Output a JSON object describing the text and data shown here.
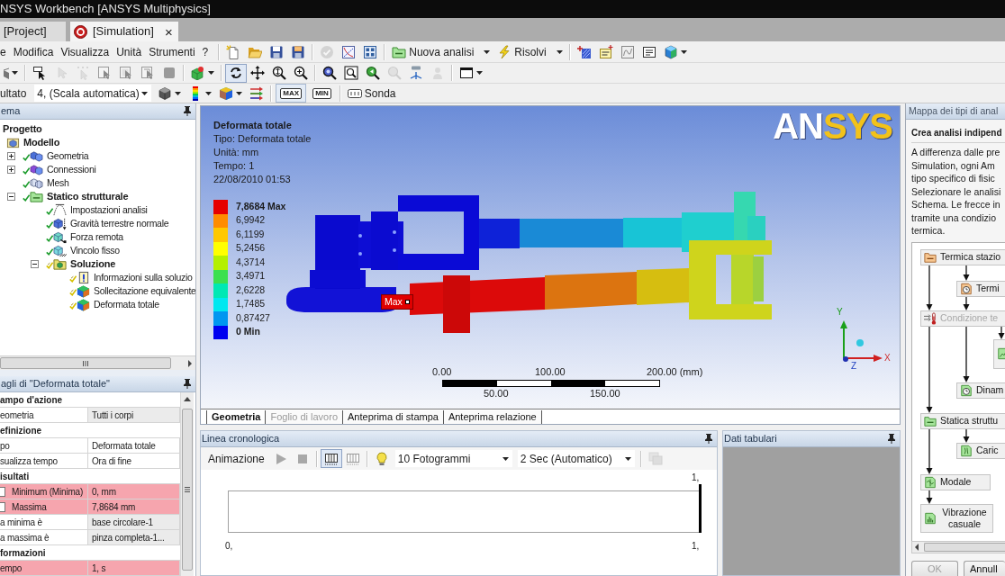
{
  "window": {
    "title": "NSYS Workbench [ANSYS Multiphysics]"
  },
  "tabs": [
    {
      "label": "[Project]",
      "selected": false
    },
    {
      "label": "[Simulation]",
      "selected": true,
      "kind": "simulation",
      "close": "×"
    }
  ],
  "menu": [
    "e",
    "Modifica",
    "Visualizza",
    "Unità",
    "Strumenti",
    "?"
  ],
  "toolbar_main": [
    [
      {
        "kind": "new",
        "disabled": false
      },
      {
        "kind": "open",
        "disabled": false
      },
      {
        "kind": "save",
        "disabled": false
      },
      {
        "kind": "save-all",
        "disabled": false
      }
    ],
    [
      {
        "kind": "check",
        "disabled": true
      },
      {
        "kind": "graph",
        "disabled": false
      },
      {
        "kind": "slides",
        "disabled": false
      }
    ],
    [
      {
        "kind": "analysis",
        "label": "Nuova analisi",
        "dropdown": true,
        "disabled": false
      },
      {
        "kind": "solve",
        "label": "Risolvi",
        "dropdown": true,
        "disabled": false
      }
    ],
    [
      {
        "kind": "annotation",
        "disabled": false
      },
      {
        "kind": "label",
        "disabled": false
      },
      {
        "kind": "chart",
        "disabled": false
      },
      {
        "kind": "text",
        "disabled": false
      },
      {
        "kind": "color-cube",
        "dropdown": true,
        "disabled": false
      }
    ]
  ],
  "toolbar_view": [
    [
      {
        "kind": "mode",
        "dropdown": true
      }
    ],
    [
      {
        "kind": "pointer",
        "disabled": false
      },
      {
        "kind": "vertex",
        "disabled": true
      },
      {
        "kind": "coords",
        "disabled": true
      },
      {
        "kind": "edge-select",
        "disabled": false
      },
      {
        "kind": "face-select",
        "disabled": false
      },
      {
        "kind": "box-select",
        "disabled": false
      },
      {
        "kind": "body",
        "disabled": false
      }
    ],
    [
      {
        "kind": "cube-add",
        "dropdown": true
      }
    ],
    [
      {
        "kind": "rotate",
        "pressed": true
      },
      {
        "kind": "pan",
        "pressed": false
      },
      {
        "kind": "zoom",
        "pressed": false
      },
      {
        "kind": "zoom-in",
        "pressed": false
      }
    ],
    [
      {
        "kind": "zoom-fit",
        "disabled": false
      },
      {
        "kind": "zoom-box",
        "disabled": false
      },
      {
        "kind": "previous",
        "disabled": false
      },
      {
        "kind": "next",
        "disabled": true
      },
      {
        "kind": "iso",
        "disabled": false
      },
      {
        "kind": "face-view",
        "disabled": true
      }
    ],
    [
      {
        "kind": "window",
        "dropdown": true
      }
    ]
  ],
  "toolbar_result": [
    [
      {
        "kind": "caption",
        "label": "ultato"
      },
      {
        "kind": "dropdown",
        "label": "4, (Scala automatica)"
      },
      {
        "kind": "display",
        "dropdown": true
      },
      {
        "kind": "legend",
        "dropdown": true
      },
      {
        "kind": "contour",
        "dropdown": true
      },
      {
        "kind": "vectors"
      }
    ],
    [
      {
        "kind": "max",
        "label": "MAX",
        "pressed": true
      },
      {
        "kind": "min",
        "label": "MIN",
        "pressed": false
      }
    ],
    [
      {
        "kind": "probe",
        "label": "Sonda"
      }
    ]
  ],
  "outline": {
    "title": "ema",
    "tree": [
      {
        "label": "Progetto",
        "children": [
          {
            "label": "Modello",
            "kind": "model",
            "children": [
              {
                "label": "Geometria",
                "kind": "geometry",
                "pending": false,
                "expanded": false
              },
              {
                "label": "Connessioni",
                "kind": "connections",
                "pending": false,
                "expanded": false
              },
              {
                "label": "Mesh",
                "kind": "mesh",
                "pending": false
              },
              {
                "label": "Statico strutturale",
                "kind": "analysis",
                "pending": false,
                "expanded": true,
                "children": [
                  {
                    "label": "Impostazioni analisi",
                    "kind": "settings",
                    "pending": false
                  },
                  {
                    "label": "Gravità terrestre normale",
                    "kind": "gravity",
                    "pending": false
                  },
                  {
                    "label": "Forza remota",
                    "kind": "force",
                    "pending": false
                  },
                  {
                    "label": "Vincolo fisso",
                    "kind": "support",
                    "pending": false
                  },
                  {
                    "label": "Soluzione",
                    "kind": "solution",
                    "pending": true,
                    "expanded": true,
                    "children": [
                      {
                        "label": "Informazioni sulla soluzio",
                        "kind": "info",
                        "pending": true
                      },
                      {
                        "label": "Sollecitazione equivalente",
                        "kind": "result",
                        "pending": true
                      },
                      {
                        "label": "Deformata totale",
                        "kind": "result",
                        "pending": true
                      }
                    ]
                  }
                ]
              }
            ]
          }
        ]
      }
    ]
  },
  "details": {
    "title": "agli di \"Deformata totale\"",
    "rows": [
      {
        "kind": "section",
        "label": "ampo d'azione"
      },
      {
        "kind": "readonly",
        "label": "eometria",
        "value": "Tutti i corpi"
      },
      {
        "kind": "section",
        "label": "efinizione"
      },
      {
        "kind": "input",
        "label": "po",
        "value": "Deformata totale"
      },
      {
        "kind": "input",
        "label": "sualizza tempo",
        "value": "Ora di fine"
      },
      {
        "kind": "section",
        "label": "isultati"
      },
      {
        "kind": "result",
        "label": "Minimum (Minima)",
        "value": "0, mm",
        "checked": false
      },
      {
        "kind": "result",
        "label": "Massima",
        "value": "7,8684 mm",
        "checked": false
      },
      {
        "kind": "readonly",
        "label": "a minima è",
        "value": "base circolare-1"
      },
      {
        "kind": "readonly",
        "label": "a massima è",
        "value": "pinza completa-1..."
      },
      {
        "kind": "section",
        "label": "formazioni"
      },
      {
        "kind": "result",
        "label": "empo",
        "value": "1, s"
      }
    ]
  },
  "viewport": {
    "title": "Deformata totale",
    "info": [
      "Tipo: Deformata totale",
      "Unità: mm",
      "Tempo: 1",
      "22/08/2010 01:53"
    ],
    "logo": [
      "AN",
      "SYS"
    ],
    "legend": [
      {
        "label": "7,8684 Max",
        "color": "#e60000"
      },
      {
        "label": "6,9942",
        "color": "#ff8c00"
      },
      {
        "label": "6,1199",
        "color": "#ffc800"
      },
      {
        "label": "5,2456",
        "color": "#ffff00"
      },
      {
        "label": "4,3714",
        "color": "#b4f000"
      },
      {
        "label": "3,4971",
        "color": "#3ce050"
      },
      {
        "label": "2,6228",
        "color": "#00e8b4"
      },
      {
        "label": "1,7485",
        "color": "#00e8f0"
      },
      {
        "label": "0,87427",
        "color": "#0096f0"
      },
      {
        "label": "0 Min",
        "color": "#0000f0"
      }
    ],
    "probe_tag": "Max",
    "axes": {
      "y": "Y",
      "x": "X",
      "z": "Z"
    },
    "scale": {
      "above": [
        "0.00",
        "100.00",
        "200.00 (mm)"
      ],
      "below": [
        "50.00",
        "150.00"
      ]
    },
    "tabs": [
      {
        "label": "Geometria",
        "selected": true,
        "disabled": false
      },
      {
        "label": "Foglio di lavoro",
        "selected": false,
        "disabled": true
      },
      {
        "label": "Anteprima di stampa",
        "selected": false,
        "disabled": false
      },
      {
        "label": "Anteprima relazione",
        "selected": false,
        "disabled": false
      }
    ]
  },
  "timeline": {
    "title": "Linea cronologica",
    "toolbar": [
      [
        {
          "kind": "caption",
          "label": "Animazione"
        },
        {
          "kind": "play"
        },
        {
          "kind": "stop"
        }
      ],
      [
        {
          "kind": "frames",
          "pressed": true
        },
        {
          "kind": "frames-alt",
          "pressed": false
        }
      ],
      [
        {
          "kind": "bulb"
        },
        {
          "kind": "dropdown",
          "label": "10 Fotogrammi"
        },
        {
          "kind": "dropdown",
          "label": "2 Sec (Automatico)"
        }
      ],
      [
        {
          "kind": "export",
          "disabled": true
        }
      ]
    ],
    "axis": {
      "current": "1,",
      "start": "0,",
      "end": "1,"
    }
  },
  "tabular_data": {
    "title": "Dati tabulari"
  },
  "analysis_map": {
    "title": "Mappa dei tipi di anal",
    "heading": "Crea analisi indipend",
    "text_lines": [
      "A differenza dalle pre",
      "Simulation, ogni Am",
      "tipo specifico di fisic",
      "Selezionare le analisi",
      "Schema. Le frecce in",
      "tramite una condizio",
      "termica."
    ],
    "nodes": [
      {
        "label": "Termica stazio",
        "kind": "thermal",
        "disabled": false
      },
      {
        "label": "Termi",
        "kind": "thermal-transient",
        "disabled": false
      },
      {
        "label": "Condizione te",
        "kind": "condition",
        "disabled": true
      },
      {
        "kind": "transient"
      },
      {
        "label": "Dinam",
        "kind": "dynamic",
        "disabled": false
      },
      {
        "label": "Statica struttu",
        "kind": "static",
        "disabled": false
      },
      {
        "label": "Caric",
        "kind": "buckling",
        "disabled": false
      },
      {
        "label": "Modale",
        "kind": "modal",
        "disabled": false
      },
      {
        "label": "Vibrazione casuale",
        "kind": "random",
        "disabled": false
      }
    ],
    "buttons": [
      {
        "label": "OK",
        "disabled": true
      },
      {
        "label": "Annull",
        "disabled": false
      }
    ]
  }
}
